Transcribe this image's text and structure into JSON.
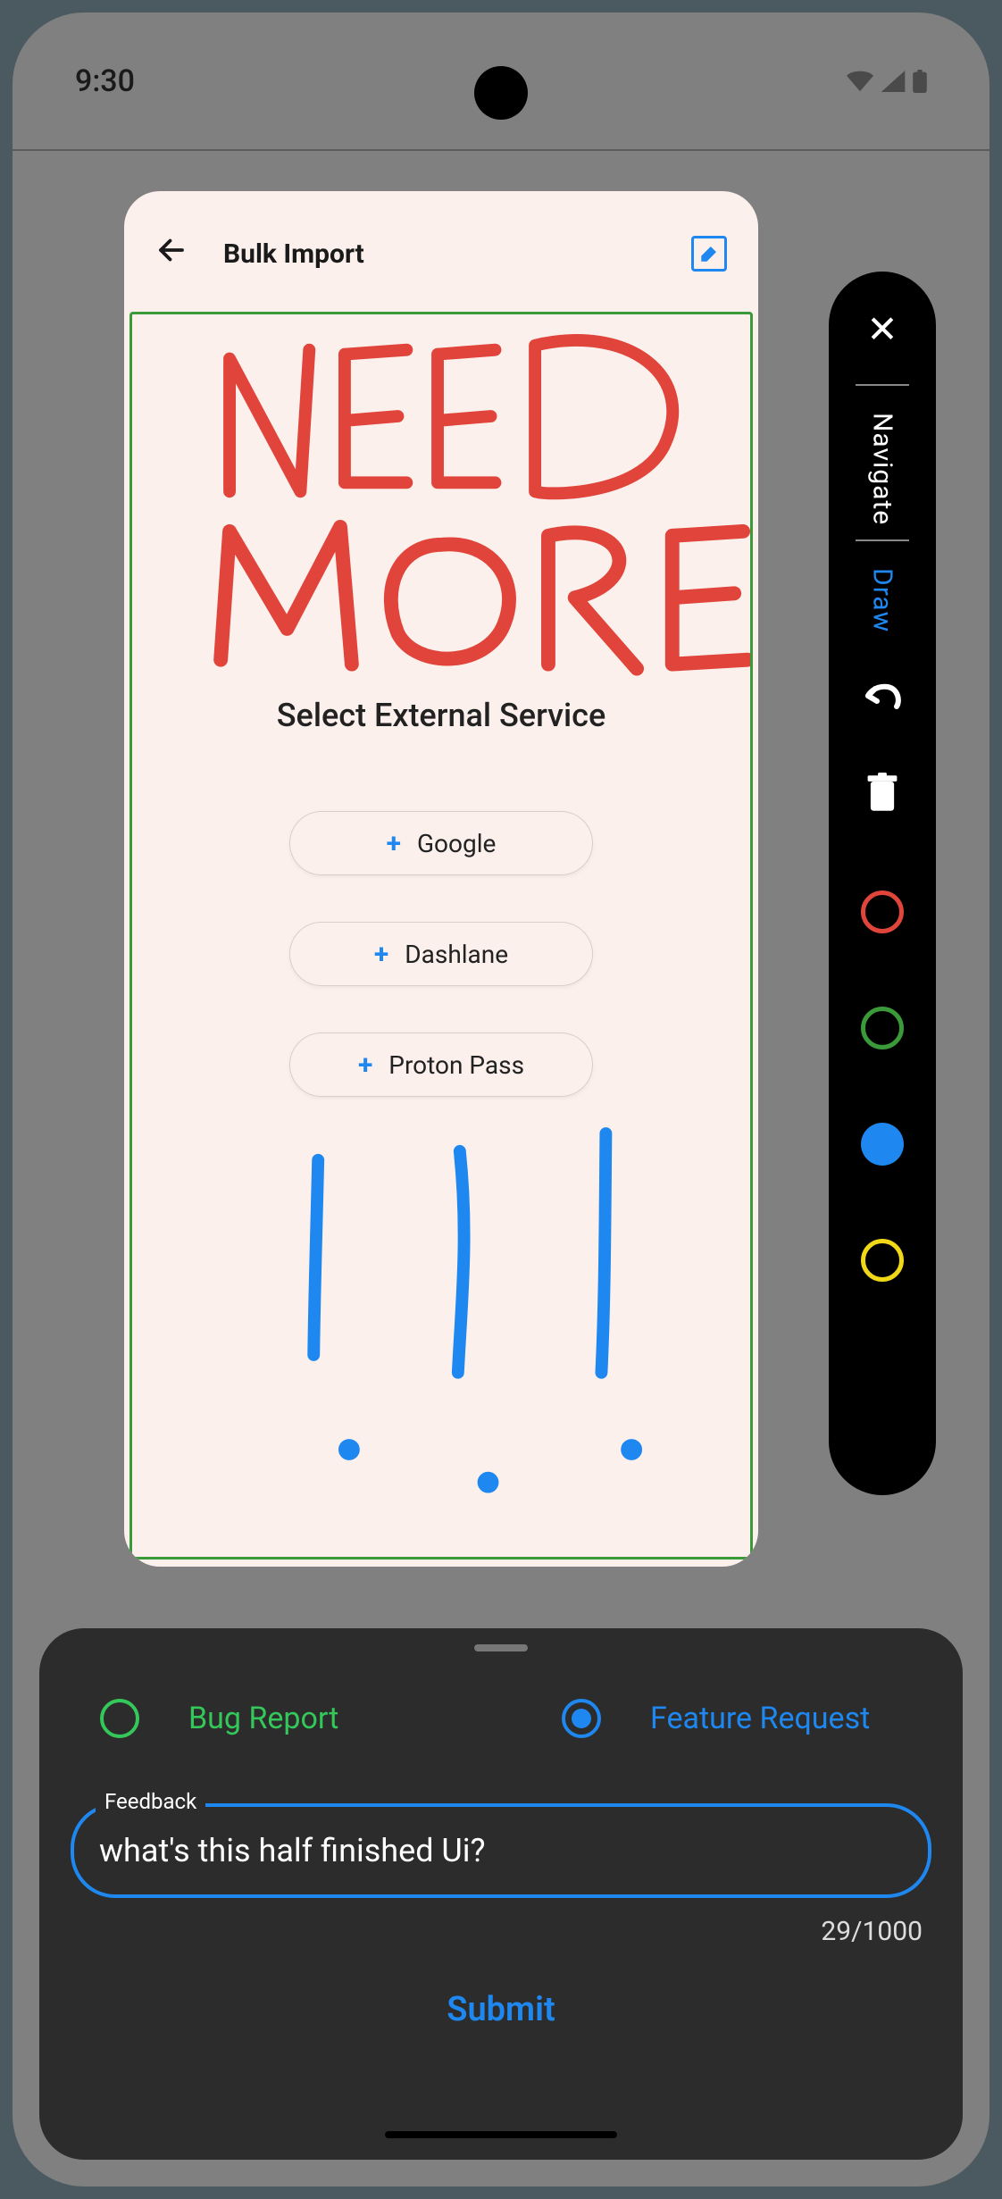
{
  "status": {
    "time": "9:30"
  },
  "card": {
    "title": "Bulk Import",
    "section_title": "Select External Service",
    "services": [
      "Google",
      "Dashlane",
      "Proton Pass"
    ]
  },
  "annotations": {
    "red_text": "NEED MORE",
    "blue_marks": "!!!"
  },
  "toolbar": {
    "navigate": "Navigate",
    "draw": "Draw",
    "colors": [
      "red",
      "green",
      "blue",
      "yellow"
    ],
    "selected_color": "blue",
    "selected_tool": "Draw"
  },
  "panel": {
    "options": {
      "bug": "Bug Report",
      "feature": "Feature Request"
    },
    "selected_option": "feature",
    "feedback_label": "Feedback",
    "feedback_value": "what's this half finished Ui?",
    "char_current": 29,
    "char_max": 1000,
    "submit": "Submit"
  }
}
